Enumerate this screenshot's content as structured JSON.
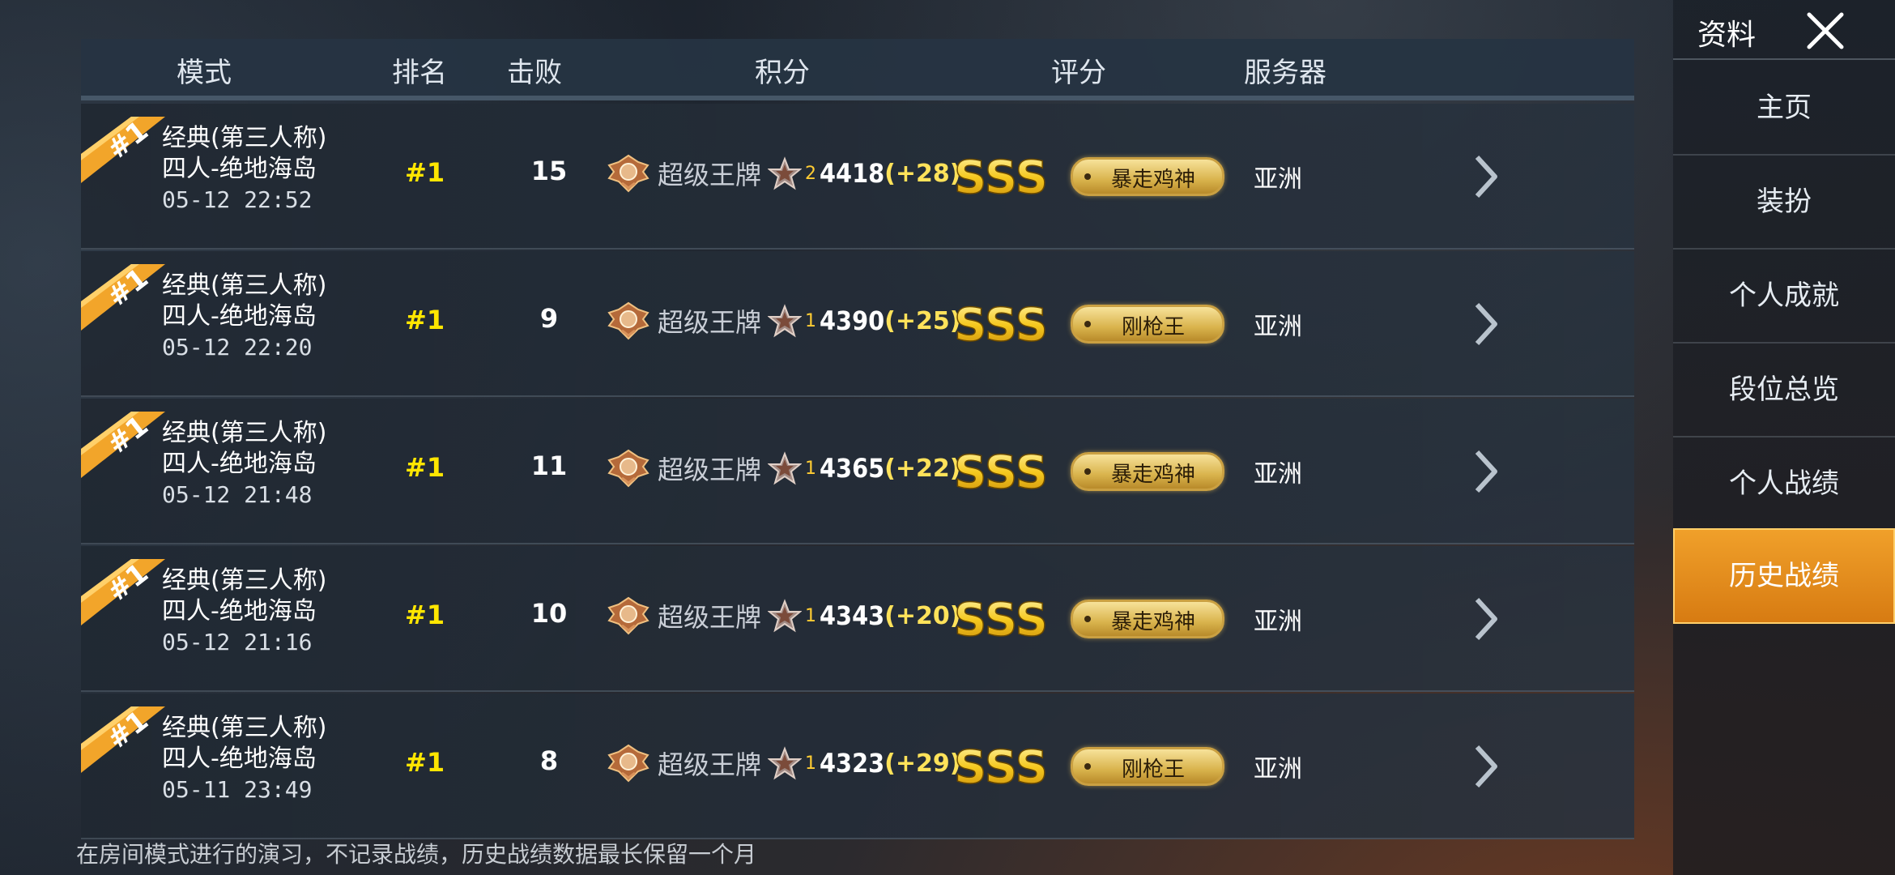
{
  "header": {
    "mode": "模式",
    "rank": "排名",
    "kills": "击败",
    "score": "积分",
    "rating": "评分",
    "server": "服务器"
  },
  "rows": [
    {
      "badge": "#1",
      "mode_line1": "经典(第三人称)",
      "mode_line2": "四人-绝地海岛",
      "date": "05-12 22:52",
      "rank": "#1",
      "kills": "15",
      "tier": "超级王牌",
      "star_level": "2",
      "points": "4418",
      "delta": "(+28)",
      "grade": "SSS",
      "title": "暴走鸡神",
      "server": "亚洲"
    },
    {
      "badge": "#1",
      "mode_line1": "经典(第三人称)",
      "mode_line2": "四人-绝地海岛",
      "date": "05-12 22:20",
      "rank": "#1",
      "kills": "9",
      "tier": "超级王牌",
      "star_level": "1",
      "points": "4390",
      "delta": "(+25)",
      "grade": "SSS",
      "title": "刚枪王",
      "server": "亚洲"
    },
    {
      "badge": "#1",
      "mode_line1": "经典(第三人称)",
      "mode_line2": "四人-绝地海岛",
      "date": "05-12 21:48",
      "rank": "#1",
      "kills": "11",
      "tier": "超级王牌",
      "star_level": "1",
      "points": "4365",
      "delta": "(+22)",
      "grade": "SSS",
      "title": "暴走鸡神",
      "server": "亚洲"
    },
    {
      "badge": "#1",
      "mode_line1": "经典(第三人称)",
      "mode_line2": "四人-绝地海岛",
      "date": "05-12 21:16",
      "rank": "#1",
      "kills": "10",
      "tier": "超级王牌",
      "star_level": "1",
      "points": "4343",
      "delta": "(+20)",
      "grade": "SSS",
      "title": "暴走鸡神",
      "server": "亚洲"
    },
    {
      "badge": "#1",
      "mode_line1": "经典(第三人称)",
      "mode_line2": "四人-绝地海岛",
      "date": "05-11 23:49",
      "rank": "#1",
      "kills": "8",
      "tier": "超级王牌",
      "star_level": "1",
      "points": "4323",
      "delta": "(+29)",
      "grade": "SSS",
      "title": "刚枪王",
      "server": "亚洲"
    }
  ],
  "note": "在房间模式进行的演习，不记录战绩，历史战绩数据最长保留一个月",
  "sidebar": {
    "title": "资料",
    "items": [
      {
        "label": "主页"
      },
      {
        "label": "装扮"
      },
      {
        "label": "个人成就"
      },
      {
        "label": "段位总览"
      },
      {
        "label": "个人战绩"
      },
      {
        "label": "历史战绩",
        "active": true
      }
    ]
  },
  "colors": {
    "accent": "#e8901e",
    "rank_yellow": "#ffe600",
    "delta_yellow": "#ffe25a"
  }
}
